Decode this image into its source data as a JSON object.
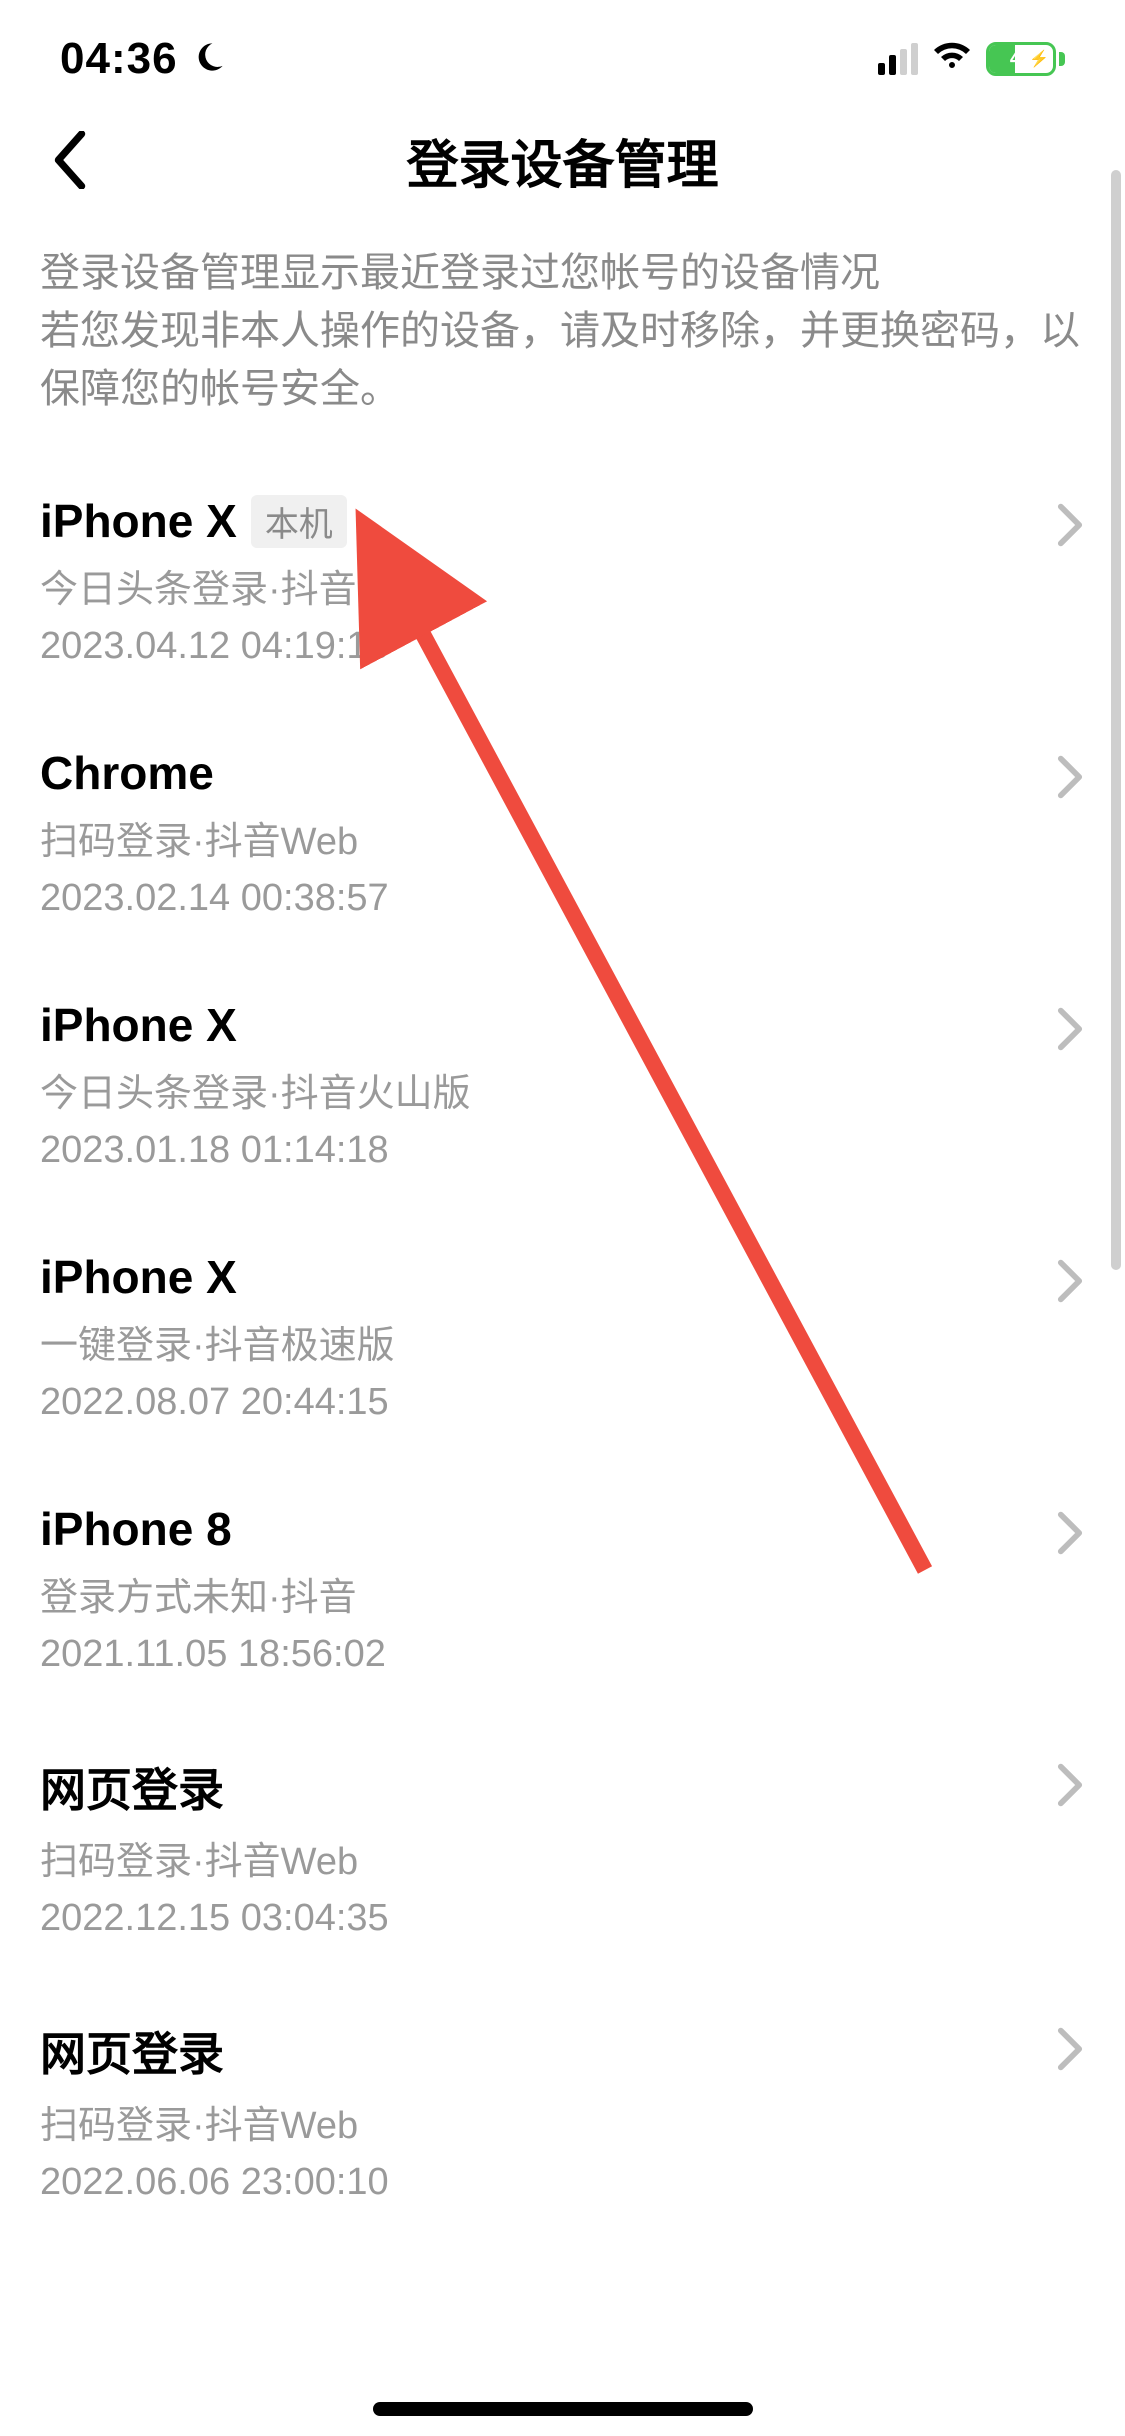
{
  "status": {
    "time": "04:36",
    "battery_percent": "40"
  },
  "header": {
    "title": "登录设备管理"
  },
  "description": {
    "line1": "登录设备管理显示最近登录过您帐号的设备情况",
    "line2": "若您发现非本人操作的设备，请及时移除，并更换密码，以保障您的帐号安全。"
  },
  "badge": {
    "current": "本机"
  },
  "devices": [
    {
      "name": "iPhone X",
      "current": true,
      "method": "今日头条登录·抖音",
      "timestamp": "2023.04.12 04:19:13"
    },
    {
      "name": "Chrome",
      "current": false,
      "method": "扫码登录·抖音Web",
      "timestamp": "2023.02.14 00:38:57"
    },
    {
      "name": "iPhone X",
      "current": false,
      "method": "今日头条登录·抖音火山版",
      "timestamp": "2023.01.18 01:14:18"
    },
    {
      "name": "iPhone X",
      "current": false,
      "method": "一键登录·抖音极速版",
      "timestamp": "2022.08.07 20:44:15"
    },
    {
      "name": "iPhone 8",
      "current": false,
      "method": "登录方式未知·抖音",
      "timestamp": "2021.11.05 18:56:02"
    },
    {
      "name": "网页登录",
      "current": false,
      "method": "扫码登录·抖音Web",
      "timestamp": "2022.12.15 03:04:35"
    },
    {
      "name": "网页登录",
      "current": false,
      "method": "扫码登录·抖音Web",
      "timestamp": "2022.06.06 23:00:10"
    }
  ],
  "colors": {
    "annotation_arrow": "#ef4b3e"
  }
}
